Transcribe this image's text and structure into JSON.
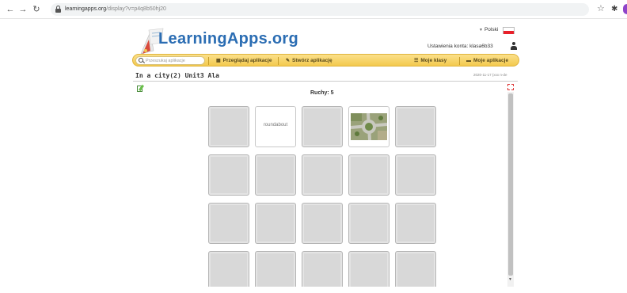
{
  "browser": {
    "url_host": "learningapps.org",
    "url_path": "/display?v=p4q8b50hj20"
  },
  "site": {
    "logo_text": "LearningApps.org",
    "language": "Polski",
    "account_label": "Ustawienia konta: klasa6b33"
  },
  "menu": {
    "search_placeholder": "Przeszukaj aplikacje",
    "items": [
      {
        "label": "Przeglądaj aplikacje"
      },
      {
        "label": "Stwórz aplikację"
      },
      {
        "label": "Moje klasy"
      },
      {
        "label": "Moje aplikacje"
      }
    ]
  },
  "app": {
    "title": "In a city(2) Unit3 Ala",
    "date": "2020-11-17 (xxx n-de",
    "moves_label": "Ruchy: 5",
    "cards": [
      {
        "state": "closed"
      },
      {
        "state": "text",
        "text": "roundabout"
      },
      {
        "state": "closed"
      },
      {
        "state": "image",
        "image": "roundabout-aerial-photo"
      },
      {
        "state": "closed"
      },
      {
        "state": "closed"
      },
      {
        "state": "closed"
      },
      {
        "state": "closed"
      },
      {
        "state": "closed"
      },
      {
        "state": "closed"
      },
      {
        "state": "closed"
      },
      {
        "state": "closed"
      },
      {
        "state": "closed"
      },
      {
        "state": "closed"
      },
      {
        "state": "closed"
      },
      {
        "state": "closed"
      },
      {
        "state": "closed"
      },
      {
        "state": "closed"
      },
      {
        "state": "closed"
      },
      {
        "state": "closed"
      }
    ]
  },
  "colors": {
    "menu_bar": "#f3c94e",
    "logo_blue": "#2b6db3",
    "card_closed": "#d8d8d8"
  }
}
